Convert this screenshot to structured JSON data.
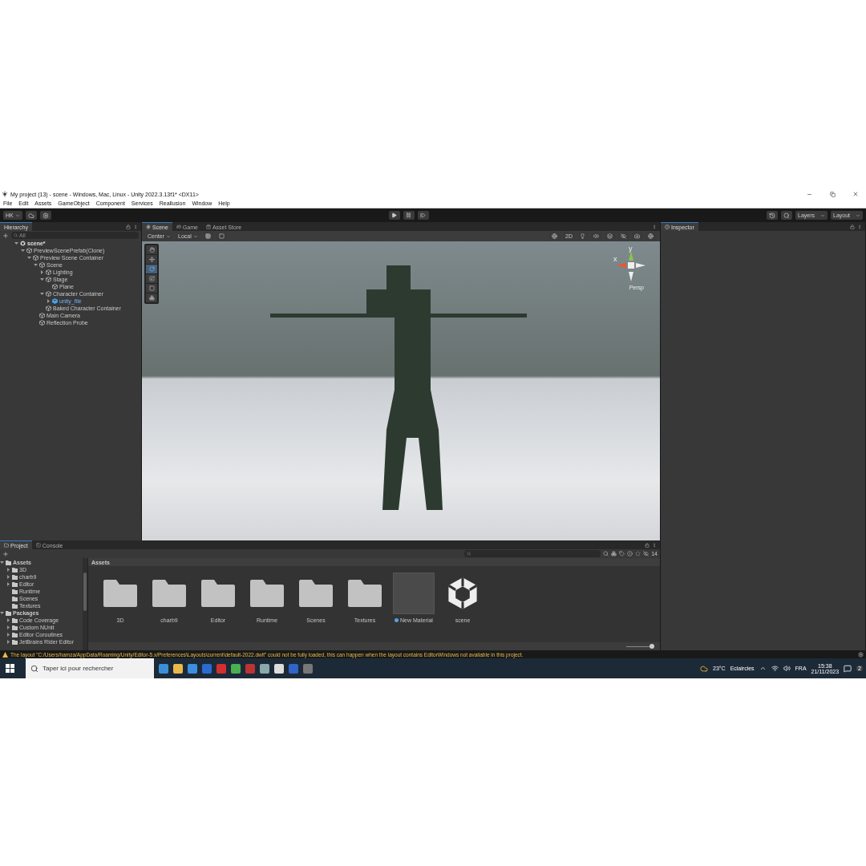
{
  "window": {
    "title": "My project (13) - scene - Windows, Mac, Linux - Unity 2022.3.13f1* <DX11>"
  },
  "menu": [
    "File",
    "Edit",
    "Assets",
    "GameObject",
    "Component",
    "Services",
    "Reallusion",
    "Window",
    "Help"
  ],
  "toolbar": {
    "account": "HK",
    "layers": "Layers",
    "layout": "Layout"
  },
  "hierarchy": {
    "title": "Hierarchy",
    "search_placeholder": "All",
    "tree": [
      {
        "label": "scene*",
        "kind": "scene",
        "expanded": true,
        "children": [
          {
            "label": "PreviewScenePrefab(Clone)",
            "kind": "object",
            "expanded": true,
            "children": [
              {
                "label": "Preview Scene Container",
                "kind": "object",
                "expanded": true,
                "children": [
                  {
                    "label": "Scene",
                    "kind": "object",
                    "expanded": true,
                    "children": [
                      {
                        "label": "Lighting",
                        "kind": "object",
                        "expanded": false
                      },
                      {
                        "label": "Stage",
                        "kind": "object",
                        "expanded": true,
                        "children": [
                          {
                            "label": "Plane",
                            "kind": "object"
                          }
                        ]
                      },
                      {
                        "label": "Character Container",
                        "kind": "object",
                        "expanded": true,
                        "children": [
                          {
                            "label": "unity_file",
                            "kind": "prefab",
                            "expanded": false
                          }
                        ]
                      },
                      {
                        "label": "Baked Character Container",
                        "kind": "object"
                      }
                    ]
                  },
                  {
                    "label": "Main Camera",
                    "kind": "object"
                  },
                  {
                    "label": "Reflection Probe",
                    "kind": "object"
                  }
                ]
              }
            ]
          }
        ]
      }
    ]
  },
  "scene_tabs": [
    {
      "label": "Scene",
      "kind": "scene",
      "selected": true
    },
    {
      "label": "Game",
      "kind": "game",
      "selected": false
    },
    {
      "label": "Asset Store",
      "kind": "store",
      "selected": false
    }
  ],
  "scene_toolbar": {
    "pivot": "Center",
    "space": "Local",
    "mode_2d": "2D"
  },
  "tools": [
    {
      "kind": "hand",
      "selected": false
    },
    {
      "kind": "move",
      "selected": false
    },
    {
      "kind": "rotate",
      "selected": true
    },
    {
      "kind": "scale",
      "selected": false
    },
    {
      "kind": "rect",
      "selected": false
    },
    {
      "kind": "transform",
      "selected": false
    }
  ],
  "gizmo": {
    "x": "x",
    "y": "y",
    "projection": "Persp"
  },
  "inspector": {
    "title": "Inspector"
  },
  "project_tabs": [
    {
      "label": "Project",
      "selected": true
    },
    {
      "label": "Console",
      "selected": false
    }
  ],
  "project_tree": [
    {
      "label": "Assets",
      "expanded": true,
      "children": [
        {
          "label": "3D",
          "expanded": false
        },
        {
          "label": "charb9",
          "expanded": false
        },
        {
          "label": "Editor",
          "expanded": false
        },
        {
          "label": "Runtime"
        },
        {
          "label": "Scenes"
        },
        {
          "label": "Textures"
        }
      ]
    },
    {
      "label": "Packages",
      "expanded": true,
      "children": [
        {
          "label": "Code Coverage",
          "expanded": false
        },
        {
          "label": "Custom NUnit",
          "expanded": false
        },
        {
          "label": "Editor Coroutines",
          "expanded": false
        },
        {
          "label": "JetBrains Rider Editor",
          "expanded": false
        }
      ]
    }
  ],
  "breadcrumb": "Assets",
  "hidden_count": "14",
  "assets": [
    {
      "label": "3D",
      "kind": "folder"
    },
    {
      "label": "charb9",
      "kind": "folder"
    },
    {
      "label": "Editor",
      "kind": "folder"
    },
    {
      "label": "Runtime",
      "kind": "folder"
    },
    {
      "label": "Scenes",
      "kind": "folder"
    },
    {
      "label": "Textures",
      "kind": "folder"
    },
    {
      "label": "New Material",
      "kind": "material"
    },
    {
      "label": "scene",
      "kind": "scene"
    }
  ],
  "icon_size": {
    "level": 1
  },
  "status": "The layout \"C:/Users/hamza/AppData/Roaming/Unity/Editor-5.x/Preferences\\Layouts\\current\\default-2022.dwlt\" could not be fully loaded, this can happen when the layout contains EditorWindows not available in this project.",
  "taskbar": {
    "search_placeholder": "Taper ici pour rechercher",
    "temperature": "23°C",
    "weather": "Eclaircies",
    "language": "FRA",
    "time": "15:38",
    "date": "21/11/2023",
    "notifications": "2"
  }
}
